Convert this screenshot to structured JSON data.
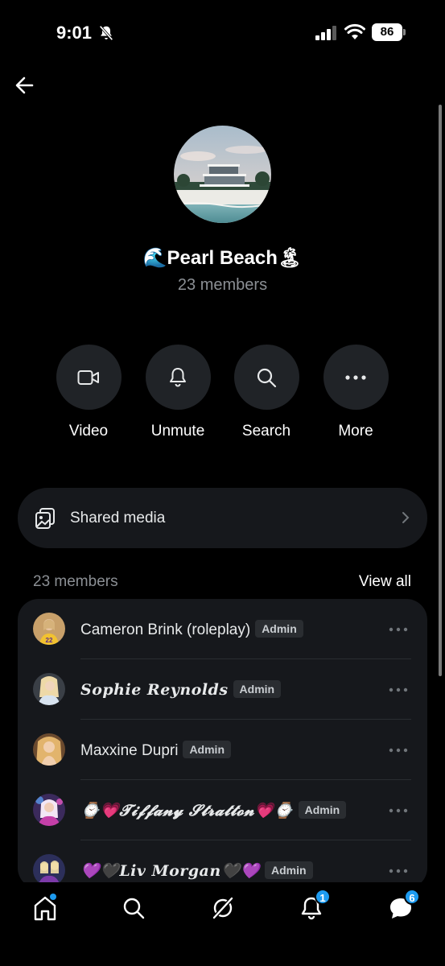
{
  "status_bar": {
    "time": "9:01",
    "battery": "86"
  },
  "group": {
    "title": "🌊Pearl Beach🏝",
    "members_subtitle": "23 members"
  },
  "actions": [
    {
      "label": "Video",
      "icon": "video-icon"
    },
    {
      "label": "Unmute",
      "icon": "bell-icon"
    },
    {
      "label": "Search",
      "icon": "search-icon"
    },
    {
      "label": "More",
      "icon": "more-icon"
    }
  ],
  "shared_media": {
    "label": "Shared media",
    "icon": "media-icon"
  },
  "members_section": {
    "count_label": "23 members",
    "view_all": "View all"
  },
  "members": [
    {
      "name": "Cameron Brink (roleplay)",
      "badge": "Admin",
      "fancy": false
    },
    {
      "name": "𝑺𝒐𝒑𝒉𝒊𝒆 𝑹𝒆𝒚𝒏𝒐𝒍𝒅𝒔",
      "badge": "Admin",
      "fancy": true
    },
    {
      "name": "Maxxine Dupri",
      "badge": "Admin",
      "fancy": false
    },
    {
      "name": "⌚💗𝓣𝓲𝓯𝓯𝓪𝓷𝔂 𝓢𝓽𝓻𝓪𝓽𝓽𝓸𝓷💗⌚",
      "badge": "Admin",
      "fancy": true
    },
    {
      "name": "💜🖤𝑳𝒊𝒗 𝑴𝒐𝒓𝒈𝒂𝒏🖤💜",
      "badge": "Admin",
      "fancy": true
    }
  ],
  "bottom_nav": {
    "items": [
      "home-icon",
      "search-icon",
      "grok-icon",
      "notifications-icon",
      "messages-icon"
    ],
    "notifications_badge": "1",
    "messages_badge": "6"
  },
  "colors": {
    "accent": "#1d9bf0",
    "background": "#000000",
    "surface": "#16181c"
  }
}
